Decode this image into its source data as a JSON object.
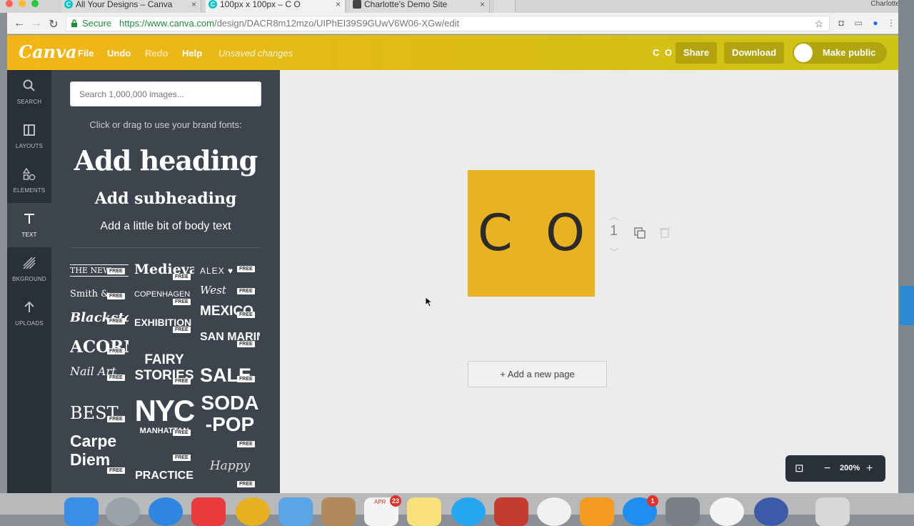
{
  "browser": {
    "tabs": [
      {
        "title": "All Your Designs – Canva",
        "active": false
      },
      {
        "title": "100px x 100px – C O",
        "active": true
      },
      {
        "title": "Charlotte's Demo Site",
        "active": false
      }
    ],
    "profile": "Charlotte",
    "secure_label": "Secure",
    "url_host": "https://www.canva.com",
    "url_path": "/design/DACR8m12mzo/UIPhEI39S9GUwV6W06-XGw/edit"
  },
  "header": {
    "logo": "Canva",
    "menu": [
      "File",
      "Undo",
      "Redo",
      "Help"
    ],
    "status": "Unsaved changes",
    "team_initials": "C O",
    "share_label": "Share",
    "download_label": "Download",
    "make_public_label": "Make public"
  },
  "rail": [
    {
      "label": "SEARCH",
      "icon": "search-icon"
    },
    {
      "label": "LAYOUTS",
      "icon": "layouts-icon"
    },
    {
      "label": "ELEMENTS",
      "icon": "elements-icon"
    },
    {
      "label": "TEXT",
      "icon": "text-icon",
      "active": true
    },
    {
      "label": "BKGROUND",
      "icon": "background-icon"
    },
    {
      "label": "UPLOADS",
      "icon": "upload-icon"
    }
  ],
  "panel": {
    "search_placeholder": "Search 1,000,000 images...",
    "hint": "Click or drag to use your brand fonts:",
    "add_heading": "Add heading",
    "add_subheading": "Add subheading",
    "add_body": "Add a little bit of body text",
    "free_label": "FREE",
    "font_combos": [
      "THE NEW",
      "Medieval",
      "ALEX ♥",
      "Smith &",
      "COPENHAGEN",
      "West",
      "Blackstad",
      "EXHIBITION",
      "MEXICO",
      "ACORN",
      "FAIRY",
      "SAN MARINO",
      "Nail Art",
      "STORIES",
      "SALE",
      "BEST",
      "NYC",
      "SODA",
      "Carpe",
      "MANHATTAN",
      "-POP",
      "Diem",
      "PRACTICE",
      "Happy"
    ]
  },
  "canvas": {
    "page_text": "C O",
    "page_color": "#e8b220",
    "page_number": "1",
    "add_page_label": "+ Add a new page",
    "zoom": "200%"
  },
  "colors": {
    "header_start": "#f3b516",
    "header_end": "#cdc417",
    "rail": "#293039",
    "panel": "#3d444d"
  },
  "dock": {
    "calendar_badge": "23",
    "calendar_month": "APR",
    "appstore_badge": "1"
  }
}
